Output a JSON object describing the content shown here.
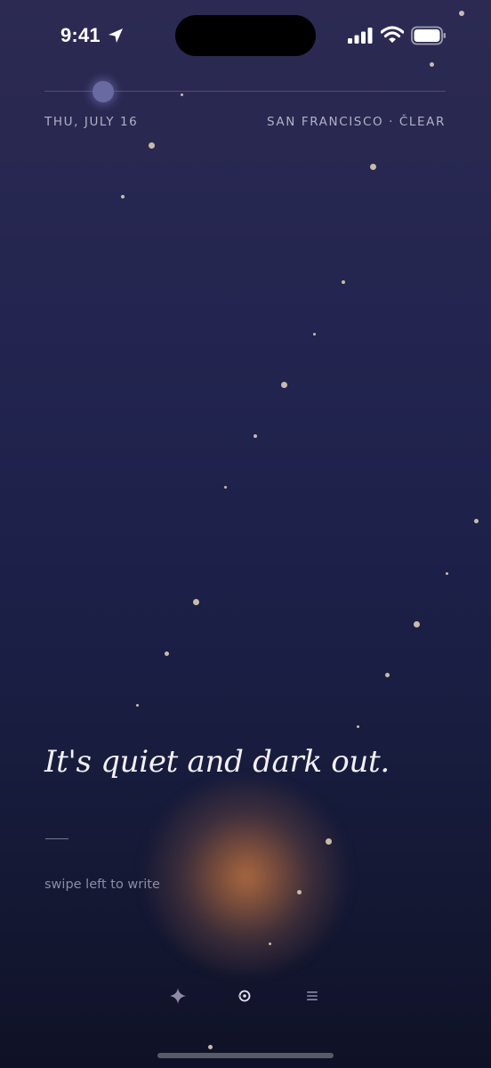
{
  "status_bar": {
    "time": "9:41",
    "icons": [
      "location-arrow-icon",
      "signal-icon",
      "wifi-icon",
      "battery-icon"
    ]
  },
  "header": {
    "date": "THU, JULY 16",
    "location": "SAN FRANCISCO · ČLEAR"
  },
  "main": {
    "headline": "It's quiet and dark out.",
    "hint": "swipe left to write"
  },
  "nav": {
    "items": [
      {
        "icon": "sparkle-icon"
      },
      {
        "icon": "target-icon"
      },
      {
        "icon": "menu-icon"
      }
    ]
  },
  "colors": {
    "sky_top": "#2c2a52",
    "sky_bottom": "#0f1226",
    "star": "#c9bca6",
    "glow": "#b26c40",
    "headline": "#f2f0f6",
    "label": "#b3b0c6"
  }
}
